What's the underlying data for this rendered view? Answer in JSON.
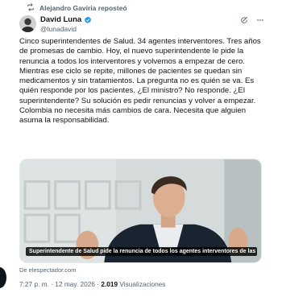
{
  "repost": {
    "text": "Alejandro Gaviria reposteó"
  },
  "author": {
    "display_name": "David Luna",
    "handle": "@lunadavid"
  },
  "tweet": {
    "text": "Cinco superintendentes de Salud. 34 agentes interventores. Tres años de promesas de cambio. Hoy, el nuevo superintendente le pide la renuncia a todos los interventores y volvemos a empezar de cero. Mientras ese ciclo se repite, millones de pacientes se quedan sin medicamentos y sin tratamientos. La pregunta no es quién se va. Es quién responde por los pacientes. ¿El ministro? No responde. ¿El superintendente? Su solución es pedir renuncias y volver a empezar. Colombia no necesita más cambios de cara. Necesita que alguien asuma la responsabilidad."
  },
  "media": {
    "caption": "Superintendente de Salud pide la renuncia de todos los agentes interventores de las E..."
  },
  "source": "De elespectador.com",
  "meta": {
    "time": "7:27 p. m.",
    "separator": " · ",
    "date": "12 may. 2026",
    "views_count": "2.019",
    "views_label": "Visualizaciones"
  },
  "icons": {
    "repost": "repost-icon",
    "verified": "verified-badge-icon",
    "grok": "grok-icon",
    "more": "more-options-icon"
  },
  "colors": {
    "text_primary": "#0f1419",
    "text_secondary": "#536471",
    "verified_blue": "#1d9bf0"
  }
}
